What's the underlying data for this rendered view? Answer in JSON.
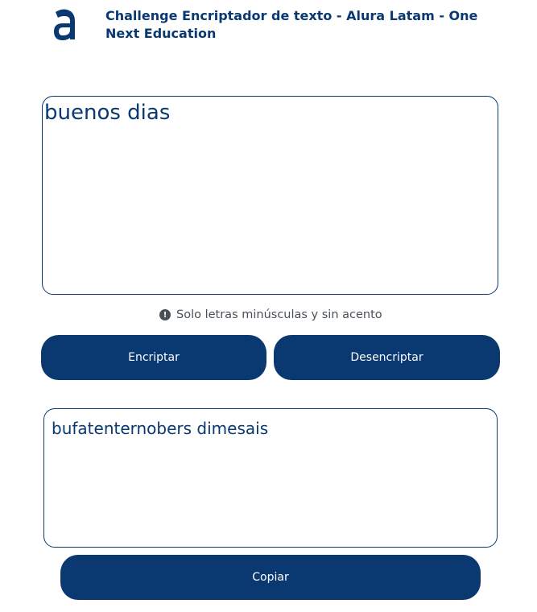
{
  "header": {
    "logo_icon": "alura-logo-icon",
    "title": "Challenge Encriptador de texto - Alura Latam - One Next Education"
  },
  "input": {
    "value": "buenos dias"
  },
  "hint": {
    "icon": "exclamation-circle-icon",
    "icon_glyph": "!",
    "text": "Solo letras minúsculas y sin acento"
  },
  "buttons": {
    "encrypt_label": "Encriptar",
    "decrypt_label": "Desencriptar",
    "copy_label": "Copiar"
  },
  "output": {
    "value": "bufatenternobers dimesais"
  },
  "colors": {
    "brand": "#0a3871",
    "hint_gray": "#495057",
    "background": "#ffffff"
  }
}
